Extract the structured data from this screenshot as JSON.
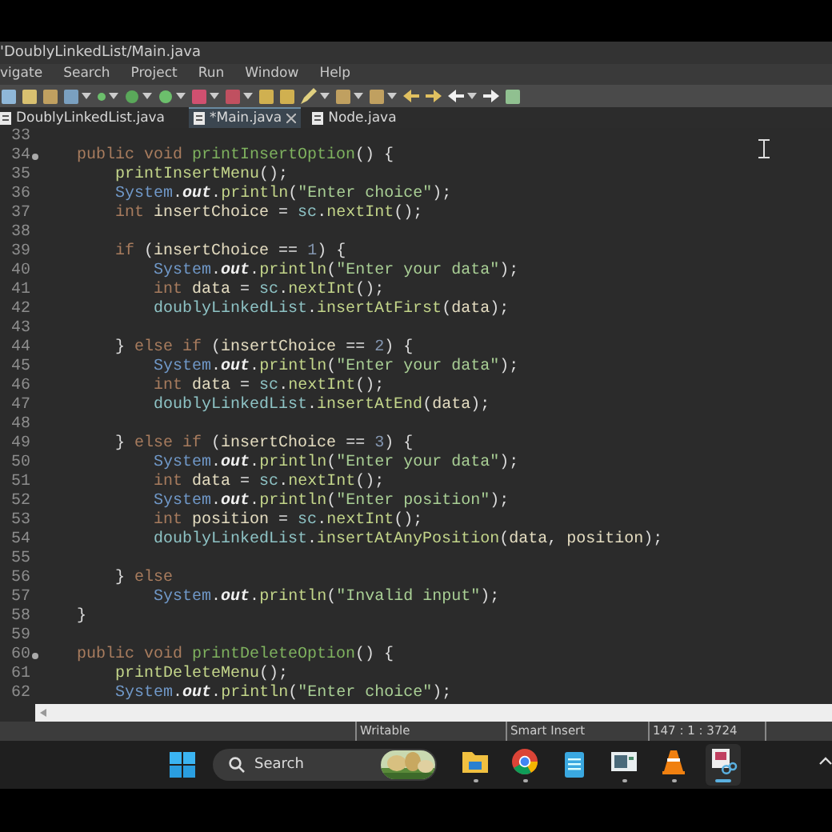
{
  "window": {
    "title": "'DoublyLinkedList/Main.java"
  },
  "menu": [
    "vigate",
    "Search",
    "Project",
    "Run",
    "Window",
    "Help"
  ],
  "tabs": [
    {
      "label": "DoublyLinkedList.java",
      "selected": false,
      "dirty_close": false
    },
    {
      "label": "*Main.java",
      "selected": true,
      "dirty_close": true
    },
    {
      "label": "Node.java",
      "selected": false,
      "dirty_close": false
    }
  ],
  "editor": {
    "lines": [
      {
        "n": "33",
        "fold": false
      },
      {
        "n": "34",
        "fold": true,
        "tokens": [
          {
            "kind": "keyword",
            "text": "public void "
          },
          {
            "kind": "declaration",
            "text": "printInsertOption"
          },
          {
            "kind": "plain",
            "text": "() {"
          }
        ]
      },
      {
        "n": "35",
        "fold": false,
        "tokens": [
          {
            "kind": "call",
            "text": "    printInsertMenu"
          },
          {
            "kind": "plain",
            "text": "();"
          }
        ]
      },
      {
        "n": "36",
        "fold": false,
        "tokens": [
          {
            "kind": "class",
            "text": "    System"
          },
          {
            "kind": "plain",
            "text": "."
          },
          {
            "kind": "static",
            "text": "out"
          },
          {
            "kind": "plain",
            "text": "."
          },
          {
            "kind": "call",
            "text": "println"
          },
          {
            "kind": "plain",
            "text": "("
          },
          {
            "kind": "string",
            "text": "\"Enter choice\""
          },
          {
            "kind": "plain",
            "text": ");"
          }
        ]
      },
      {
        "n": "37",
        "fold": false,
        "tokens": [
          {
            "kind": "keyword",
            "text": "    int "
          },
          {
            "kind": "variable",
            "text": "insertChoice"
          },
          {
            "kind": "plain",
            "text": " = "
          },
          {
            "kind": "field",
            "text": "sc"
          },
          {
            "kind": "plain",
            "text": "."
          },
          {
            "kind": "call",
            "text": "nextInt"
          },
          {
            "kind": "plain",
            "text": "();"
          }
        ]
      },
      {
        "n": "38",
        "fold": false
      },
      {
        "n": "39",
        "fold": false,
        "tokens": [
          {
            "kind": "keyword",
            "text": "    if "
          },
          {
            "kind": "plain",
            "text": "("
          },
          {
            "kind": "variable",
            "text": "insertChoice"
          },
          {
            "kind": "plain",
            "text": " == "
          },
          {
            "kind": "number",
            "text": "1"
          },
          {
            "kind": "plain",
            "text": ") {"
          }
        ]
      },
      {
        "n": "40",
        "fold": false,
        "tokens": [
          {
            "kind": "class",
            "text": "        System"
          },
          {
            "kind": "plain",
            "text": "."
          },
          {
            "kind": "static",
            "text": "out"
          },
          {
            "kind": "plain",
            "text": "."
          },
          {
            "kind": "call",
            "text": "println"
          },
          {
            "kind": "plain",
            "text": "("
          },
          {
            "kind": "string",
            "text": "\"Enter your data\""
          },
          {
            "kind": "plain",
            "text": ");"
          }
        ]
      },
      {
        "n": "41",
        "fold": false,
        "tokens": [
          {
            "kind": "keyword",
            "text": "        int "
          },
          {
            "kind": "variable",
            "text": "data"
          },
          {
            "kind": "plain",
            "text": " = "
          },
          {
            "kind": "field",
            "text": "sc"
          },
          {
            "kind": "plain",
            "text": "."
          },
          {
            "kind": "call",
            "text": "nextInt"
          },
          {
            "kind": "plain",
            "text": "();"
          }
        ]
      },
      {
        "n": "42",
        "fold": false,
        "tokens": [
          {
            "kind": "field",
            "text": "        doublyLinkedList"
          },
          {
            "kind": "plain",
            "text": "."
          },
          {
            "kind": "call",
            "text": "insertAtFirst"
          },
          {
            "kind": "plain",
            "text": "("
          },
          {
            "kind": "variable",
            "text": "data"
          },
          {
            "kind": "plain",
            "text": ");"
          }
        ]
      },
      {
        "n": "43",
        "fold": false
      },
      {
        "n": "44",
        "fold": false,
        "tokens": [
          {
            "kind": "plain",
            "text": "    } "
          },
          {
            "kind": "keyword",
            "text": "else if "
          },
          {
            "kind": "plain",
            "text": "("
          },
          {
            "kind": "variable",
            "text": "insertChoice"
          },
          {
            "kind": "plain",
            "text": " == "
          },
          {
            "kind": "number",
            "text": "2"
          },
          {
            "kind": "plain",
            "text": ") {"
          }
        ]
      },
      {
        "n": "45",
        "fold": false,
        "tokens": [
          {
            "kind": "class",
            "text": "        System"
          },
          {
            "kind": "plain",
            "text": "."
          },
          {
            "kind": "static",
            "text": "out"
          },
          {
            "kind": "plain",
            "text": "."
          },
          {
            "kind": "call",
            "text": "println"
          },
          {
            "kind": "plain",
            "text": "("
          },
          {
            "kind": "string",
            "text": "\"Enter your data\""
          },
          {
            "kind": "plain",
            "text": ");"
          }
        ]
      },
      {
        "n": "46",
        "fold": false,
        "tokens": [
          {
            "kind": "keyword",
            "text": "        int "
          },
          {
            "kind": "variable",
            "text": "data"
          },
          {
            "kind": "plain",
            "text": " = "
          },
          {
            "kind": "field",
            "text": "sc"
          },
          {
            "kind": "plain",
            "text": "."
          },
          {
            "kind": "call",
            "text": "nextInt"
          },
          {
            "kind": "plain",
            "text": "();"
          }
        ]
      },
      {
        "n": "47",
        "fold": false,
        "tokens": [
          {
            "kind": "field",
            "text": "        doublyLinkedList"
          },
          {
            "kind": "plain",
            "text": "."
          },
          {
            "kind": "call",
            "text": "insertAtEnd"
          },
          {
            "kind": "plain",
            "text": "("
          },
          {
            "kind": "variable",
            "text": "data"
          },
          {
            "kind": "plain",
            "text": ");"
          }
        ]
      },
      {
        "n": "48",
        "fold": false
      },
      {
        "n": "49",
        "fold": false,
        "tokens": [
          {
            "kind": "plain",
            "text": "    } "
          },
          {
            "kind": "keyword",
            "text": "else if "
          },
          {
            "kind": "plain",
            "text": "("
          },
          {
            "kind": "variable",
            "text": "insertChoice"
          },
          {
            "kind": "plain",
            "text": " == "
          },
          {
            "kind": "number",
            "text": "3"
          },
          {
            "kind": "plain",
            "text": ") {"
          }
        ]
      },
      {
        "n": "50",
        "fold": false,
        "tokens": [
          {
            "kind": "class",
            "text": "        System"
          },
          {
            "kind": "plain",
            "text": "."
          },
          {
            "kind": "static",
            "text": "out"
          },
          {
            "kind": "plain",
            "text": "."
          },
          {
            "kind": "call",
            "text": "println"
          },
          {
            "kind": "plain",
            "text": "("
          },
          {
            "kind": "string",
            "text": "\"Enter your data\""
          },
          {
            "kind": "plain",
            "text": ");"
          }
        ]
      },
      {
        "n": "51",
        "fold": false,
        "tokens": [
          {
            "kind": "keyword",
            "text": "        int "
          },
          {
            "kind": "variable",
            "text": "data"
          },
          {
            "kind": "plain",
            "text": " = "
          },
          {
            "kind": "field",
            "text": "sc"
          },
          {
            "kind": "plain",
            "text": "."
          },
          {
            "kind": "call",
            "text": "nextInt"
          },
          {
            "kind": "plain",
            "text": "();"
          }
        ]
      },
      {
        "n": "52",
        "fold": false,
        "tokens": [
          {
            "kind": "class",
            "text": "        System"
          },
          {
            "kind": "plain",
            "text": "."
          },
          {
            "kind": "static",
            "text": "out"
          },
          {
            "kind": "plain",
            "text": "."
          },
          {
            "kind": "call",
            "text": "println"
          },
          {
            "kind": "plain",
            "text": "("
          },
          {
            "kind": "string",
            "text": "\"Enter position\""
          },
          {
            "kind": "plain",
            "text": ");"
          }
        ]
      },
      {
        "n": "53",
        "fold": false,
        "tokens": [
          {
            "kind": "keyword",
            "text": "        int "
          },
          {
            "kind": "variable",
            "text": "position"
          },
          {
            "kind": "plain",
            "text": " = "
          },
          {
            "kind": "field",
            "text": "sc"
          },
          {
            "kind": "plain",
            "text": "."
          },
          {
            "kind": "call",
            "text": "nextInt"
          },
          {
            "kind": "plain",
            "text": "();"
          }
        ]
      },
      {
        "n": "54",
        "fold": false,
        "tokens": [
          {
            "kind": "field",
            "text": "        doublyLinkedList"
          },
          {
            "kind": "plain",
            "text": "."
          },
          {
            "kind": "call",
            "text": "insertAtAnyPosition"
          },
          {
            "kind": "plain",
            "text": "("
          },
          {
            "kind": "variable",
            "text": "data"
          },
          {
            "kind": "plain",
            "text": ", "
          },
          {
            "kind": "variable",
            "text": "position"
          },
          {
            "kind": "plain",
            "text": ");"
          }
        ]
      },
      {
        "n": "55",
        "fold": false
      },
      {
        "n": "56",
        "fold": false,
        "tokens": [
          {
            "kind": "plain",
            "text": "    } "
          },
          {
            "kind": "keyword",
            "text": "else"
          }
        ]
      },
      {
        "n": "57",
        "fold": false,
        "tokens": [
          {
            "kind": "class",
            "text": "        System"
          },
          {
            "kind": "plain",
            "text": "."
          },
          {
            "kind": "static",
            "text": "out"
          },
          {
            "kind": "plain",
            "text": "."
          },
          {
            "kind": "call",
            "text": "println"
          },
          {
            "kind": "plain",
            "text": "("
          },
          {
            "kind": "string",
            "text": "\"Invalid input\""
          },
          {
            "kind": "plain",
            "text": ");"
          }
        ]
      },
      {
        "n": "58",
        "fold": false,
        "tokens": [
          {
            "kind": "plain",
            "text": "}"
          }
        ]
      },
      {
        "n": "59",
        "fold": false
      },
      {
        "n": "60",
        "fold": true,
        "tokens": [
          {
            "kind": "keyword",
            "text": "public void "
          },
          {
            "kind": "declaration",
            "text": "printDeleteOption"
          },
          {
            "kind": "plain",
            "text": "() {"
          }
        ]
      },
      {
        "n": "61",
        "fold": false,
        "tokens": [
          {
            "kind": "call",
            "text": "    printDeleteMenu"
          },
          {
            "kind": "plain",
            "text": "();"
          }
        ]
      },
      {
        "n": "62",
        "fold": false,
        "tokens": [
          {
            "kind": "class",
            "text": "    System"
          },
          {
            "kind": "plain",
            "text": "."
          },
          {
            "kind": "static",
            "text": "out"
          },
          {
            "kind": "plain",
            "text": "."
          },
          {
            "kind": "call",
            "text": "println"
          },
          {
            "kind": "plain",
            "text": "("
          },
          {
            "kind": "string",
            "text": "\"Enter choice\""
          },
          {
            "kind": "plain",
            "text": ");"
          }
        ]
      }
    ]
  },
  "status_bar": [
    "Writable",
    "Smart Insert",
    "147 : 1 : 3724"
  ],
  "taskbar": {
    "search": {
      "label": "Search"
    },
    "apps": [
      {
        "kind": "folder",
        "running": true,
        "selected": false
      },
      {
        "kind": "browser",
        "running": true,
        "selected": false
      },
      {
        "kind": "notepad",
        "running": false,
        "selected": false
      },
      {
        "kind": "window",
        "running": true,
        "selected": false
      },
      {
        "kind": "cone",
        "running": true,
        "selected": false
      },
      {
        "kind": "snip",
        "running": false,
        "selected": true
      }
    ]
  }
}
